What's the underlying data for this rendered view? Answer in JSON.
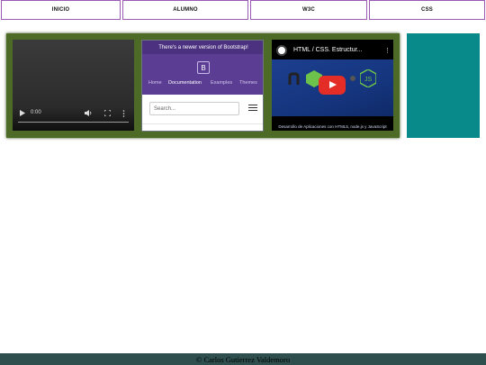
{
  "nav": {
    "items": [
      {
        "label": "INICIO"
      },
      {
        "label": "ALUMNO"
      },
      {
        "label": "W3C"
      },
      {
        "label": "CSS"
      }
    ]
  },
  "video": {
    "time": "0:00"
  },
  "bootstrap_frame": {
    "banner": "There's a newer version of Bootstrap!",
    "logo": "B",
    "nav": [
      "Home",
      "Documentation",
      "Examples",
      "Themes"
    ],
    "search_placeholder": "Search..."
  },
  "youtube": {
    "title": "HTML / CSS. Estructur...",
    "subtitle": "Desarrollo de Aplicaciones con HTML5, node.js y JavaScript"
  },
  "colors": {
    "panel": "#4d6b26",
    "teal_block": "#098a8a",
    "nav_border": "#9b59b6",
    "footer": "#2f4f4f",
    "bootstrap_purple": "#5b3d94",
    "youtube_red": "#e52d27"
  },
  "footer": {
    "text": "© Carlos Gutierrez Valdemoro"
  }
}
